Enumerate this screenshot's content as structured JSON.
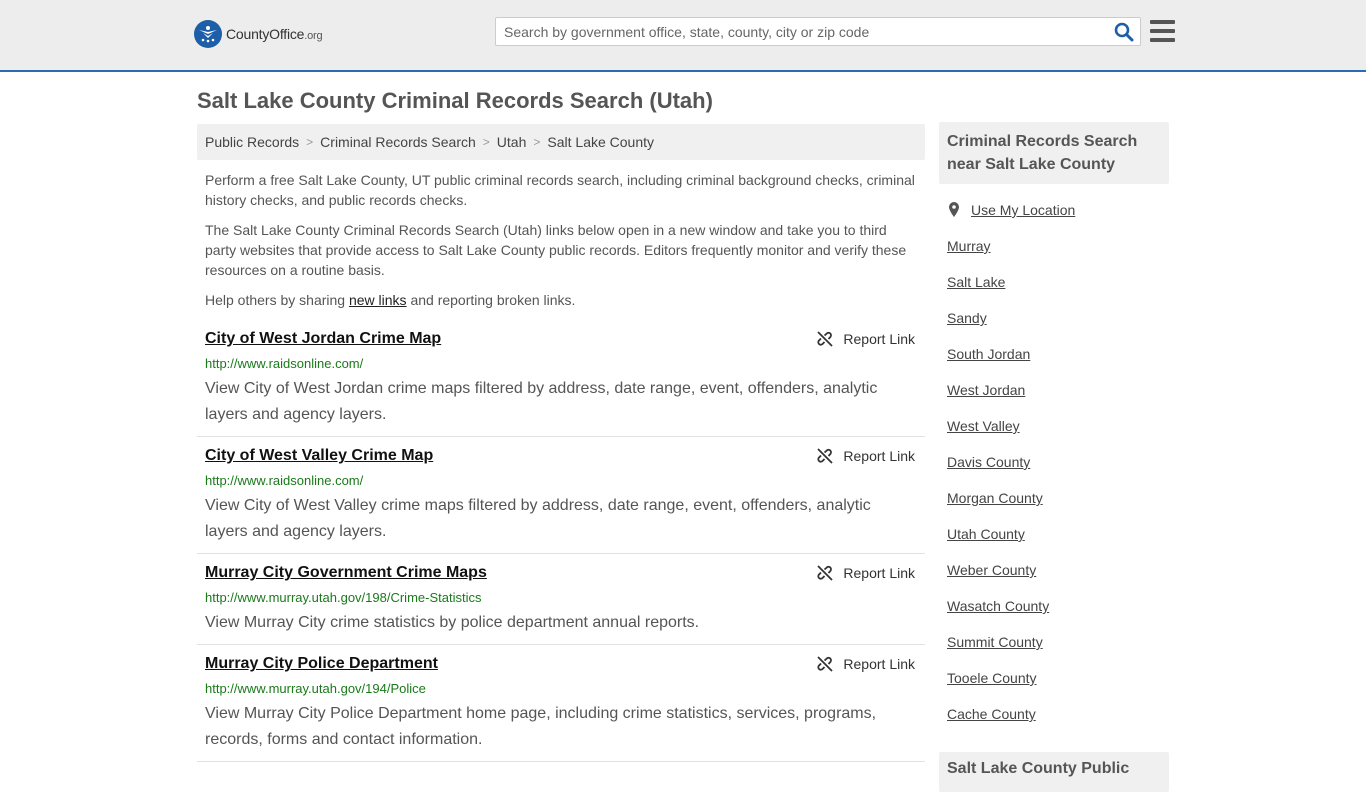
{
  "header": {
    "logo_main": "CountyOffice",
    "logo_suffix": ".org",
    "search_placeholder": "Search by government office, state, county, city or zip code"
  },
  "page_title": "Salt Lake County Criminal Records Search (Utah)",
  "breadcrumb": [
    "Public Records",
    "Criminal Records Search",
    "Utah",
    "Salt Lake County"
  ],
  "intro": {
    "p1": "Perform a free Salt Lake County, UT public criminal records search, including criminal background checks, criminal history checks, and public records checks.",
    "p2": "The Salt Lake County Criminal Records Search (Utah) links below open in a new window and take you to third party websites that provide access to Salt Lake County public records. Editors frequently monitor and verify these resources on a routine basis.",
    "p3_before": "Help others by sharing ",
    "p3_link": "new links",
    "p3_after": " and reporting broken links."
  },
  "report_label": "Report Link",
  "results": [
    {
      "title": "City of West Jordan Crime Map",
      "url": "http://www.raidsonline.com/",
      "desc": "View City of West Jordan crime maps filtered by address, date range, event, offenders, analytic layers and agency layers."
    },
    {
      "title": "City of West Valley Crime Map",
      "url": "http://www.raidsonline.com/",
      "desc": "View City of West Valley crime maps filtered by address, date range, event, offenders, analytic layers and agency layers."
    },
    {
      "title": "Murray City Government Crime Maps",
      "url": "http://www.murray.utah.gov/198/Crime-Statistics",
      "desc": "View Murray City crime statistics by police department annual reports."
    },
    {
      "title": "Murray City Police Department",
      "url": "http://www.murray.utah.gov/194/Police",
      "desc": "View Murray City Police Department home page, including crime statistics, services, programs, records, forms and contact information."
    }
  ],
  "sidebar": {
    "heading": "Criminal Records Search near Salt Lake County",
    "use_location": "Use My Location",
    "links": [
      "Murray",
      "Salt Lake",
      "Sandy",
      "South Jordan",
      "West Jordan",
      "West Valley",
      "Davis County",
      "Morgan County",
      "Utah County",
      "Weber County",
      "Wasatch County",
      "Summit County",
      "Tooele County",
      "Cache County"
    ],
    "heading2": "Salt Lake County Public"
  },
  "colors": {
    "accent": "#2b6bb3",
    "url_green": "#1a7a1a"
  }
}
